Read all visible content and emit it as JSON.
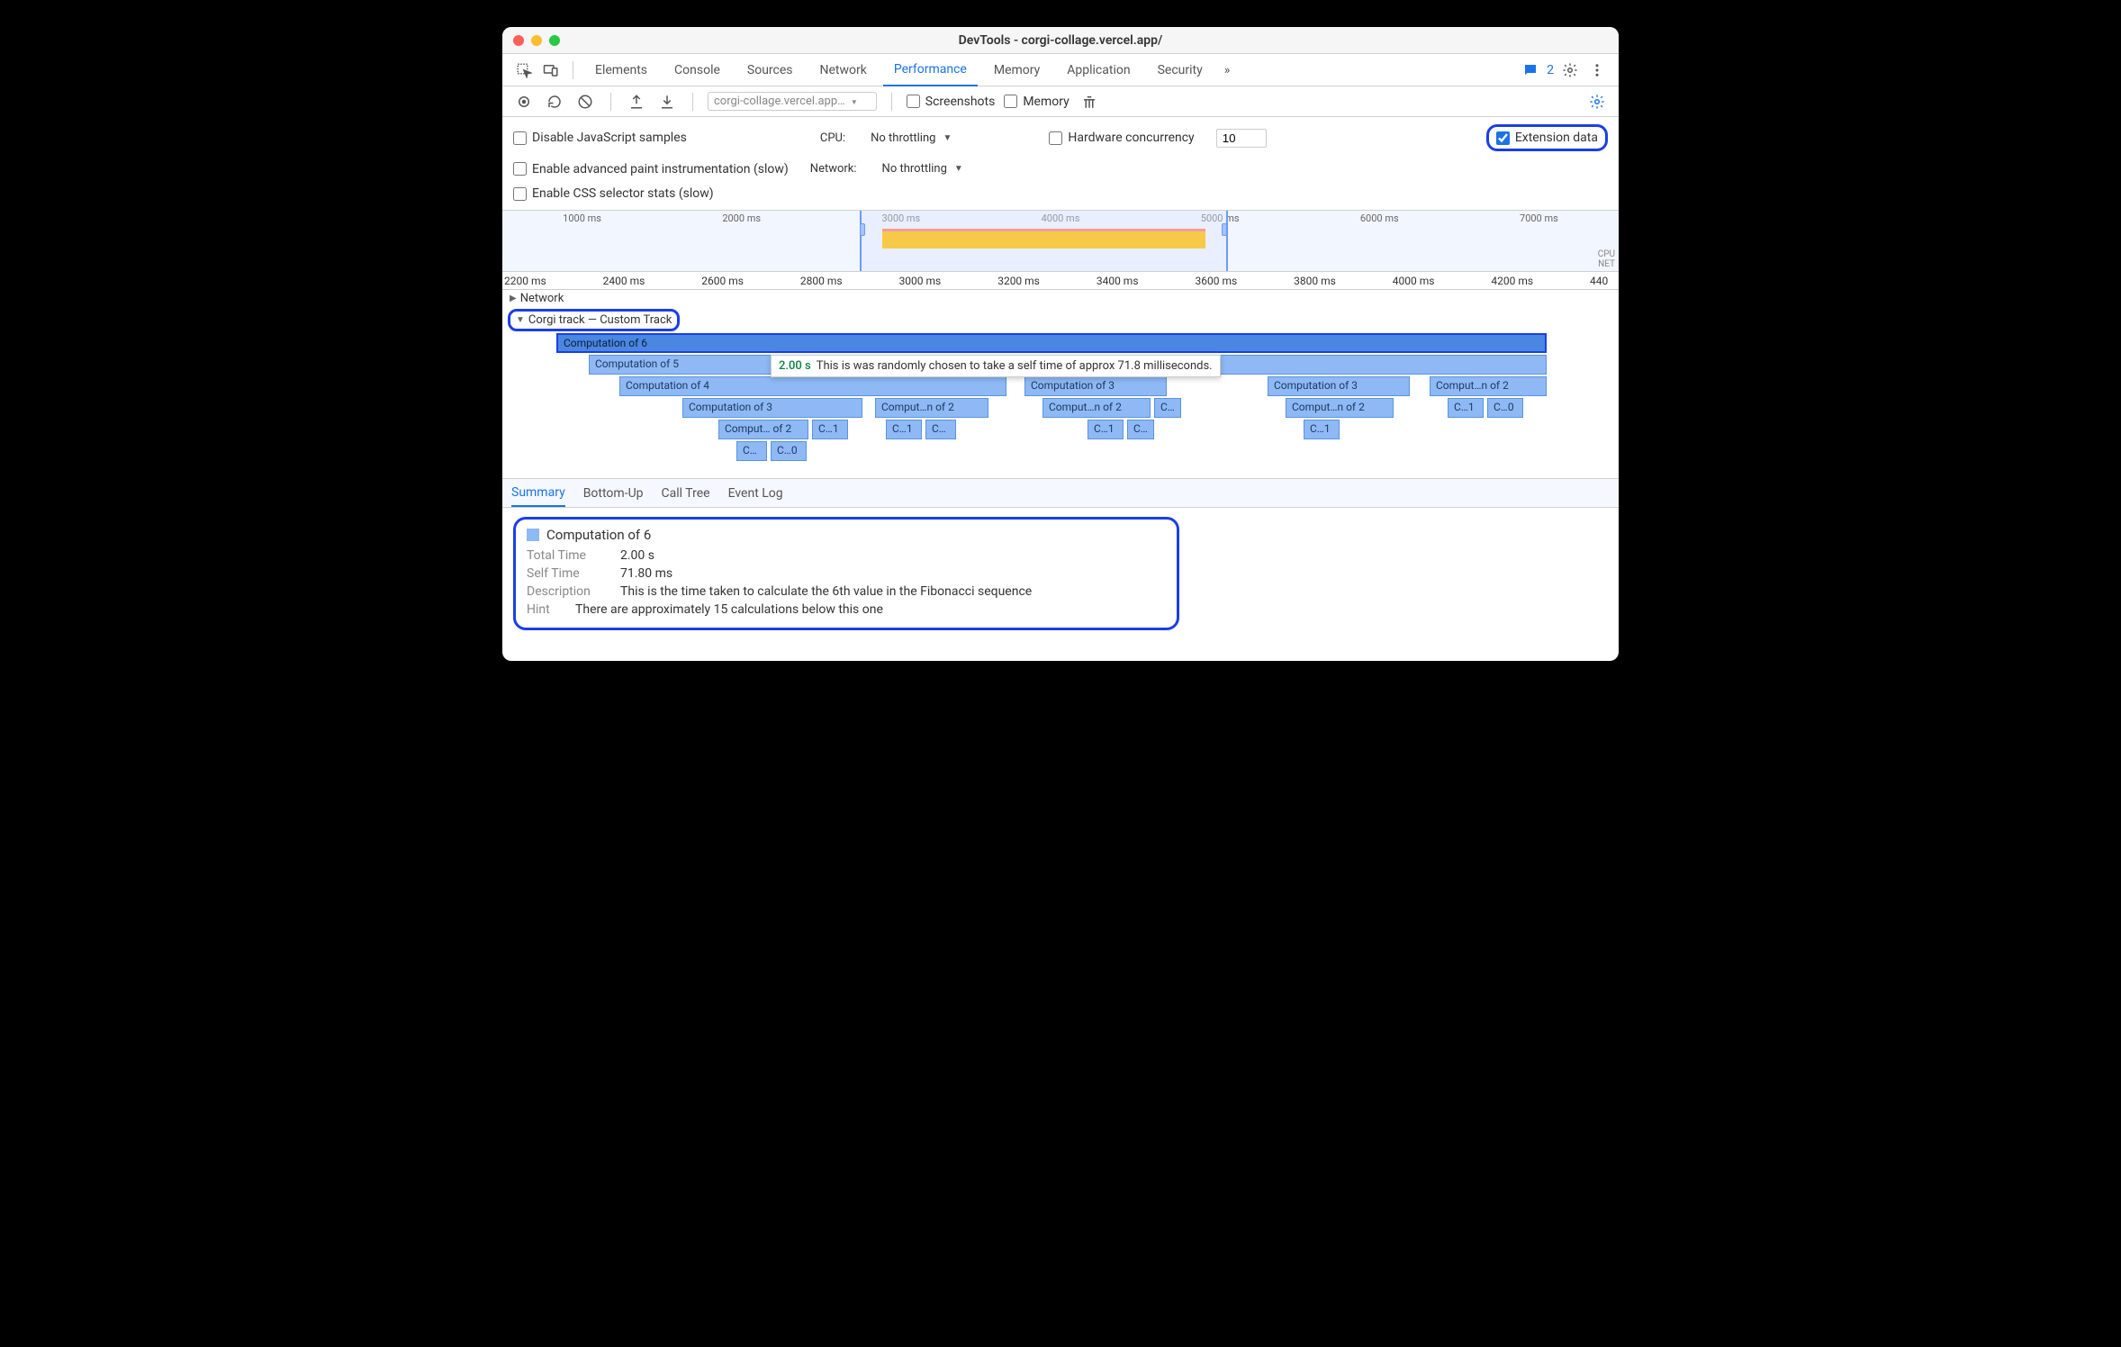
{
  "window": {
    "title": "DevTools - corgi-collage.vercel.app/"
  },
  "tabs": {
    "items": [
      "Elements",
      "Console",
      "Sources",
      "Network",
      "Performance",
      "Memory",
      "Application",
      "Security"
    ],
    "active": "Performance",
    "issue_count": "2"
  },
  "toolbar": {
    "dropdown": "corgi-collage.vercel.app…",
    "screenshots_label": "Screenshots",
    "memory_label": "Memory"
  },
  "options": {
    "disable_js": "Disable JavaScript samples",
    "cpu_label": "CPU:",
    "cpu_value": "No throttling",
    "hw_label": "Hardware concurrency",
    "hw_value": "10",
    "extension_label": "Extension data",
    "advanced_paint": "Enable advanced paint instrumentation (slow)",
    "network_label": "Network:",
    "network_value": "No throttling",
    "css_stats": "Enable CSS selector stats (slow)"
  },
  "overview": {
    "ticks": [
      "1000 ms",
      "2000 ms",
      "3000 ms",
      "4000 ms",
      "5000 ms",
      "6000 ms",
      "7000 ms"
    ],
    "row_labels": [
      "CPU",
      "NET"
    ]
  },
  "ruler": {
    "ticks": [
      "2200 ms",
      "2400 ms",
      "2600 ms",
      "2800 ms",
      "3000 ms",
      "3200 ms",
      "3400 ms",
      "3600 ms",
      "3800 ms",
      "4000 ms",
      "4200 ms",
      "440"
    ]
  },
  "tracks": {
    "network": "Network",
    "custom": "Corgi track — Custom Track",
    "bars": {
      "c6": "Computation of 6",
      "c5": "Computation of 5",
      "c4a": "Computation of 4",
      "c3a": "Computation of 3",
      "c2a": "Comput… of 2",
      "c1a": "C…1",
      "c0a": "C…",
      "c0b": "C…0",
      "c2b": "Comput…n of 2",
      "c1b": "C…1",
      "c0c": "C…",
      "c3b": "Computation of 3",
      "c2c": "Comput…n of 2",
      "c1c": "C…1",
      "c0d": "C…",
      "c0e": "C…",
      "c3c": "Computation of 3",
      "c2d": "Comput…n of 2",
      "c1d": "C…1",
      "c2e": "Comput…n of 2",
      "c1e": "C…1",
      "c0f": "C…0"
    },
    "tooltip": {
      "time": "2.00 s",
      "text": "This is was randomly chosen to take a self time of approx 71.8 milliseconds."
    }
  },
  "detail_tabs": {
    "items": [
      "Summary",
      "Bottom-Up",
      "Call Tree",
      "Event Log"
    ],
    "active": "Summary"
  },
  "summary": {
    "title": "Computation of 6",
    "rows": {
      "total_k": "Total Time",
      "total_v": "2.00 s",
      "self_k": "Self Time",
      "self_v": "71.80 ms",
      "desc_k": "Description",
      "desc_v": "This is the time taken to calculate the 6th value in the Fibonacci sequence",
      "hint_k": "Hint",
      "hint_v": "There are approximately 15 calculations below this one"
    }
  }
}
